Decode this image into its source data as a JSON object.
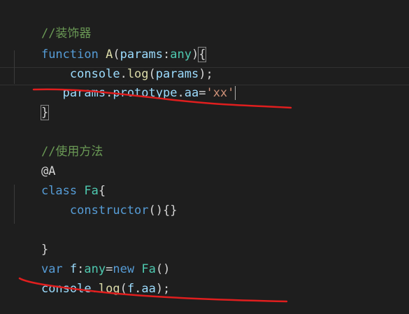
{
  "theme": {
    "background": "#1e1e1e",
    "comment": "#6a9955",
    "keyword": "#569cd6",
    "function": "#dcdcaa",
    "variable": "#9cdcfe",
    "type": "#4ec9b0",
    "string": "#ce9178",
    "text": "#d4d4d4",
    "annotation": "#e01e1e"
  },
  "code": {
    "l1": {
      "comment": "//装饰器"
    },
    "l2": {
      "kw": "function",
      "sp1": " ",
      "fn": "A",
      "p1": "(",
      "param": "params",
      "colon": ":",
      "type": "any",
      "p2": ")",
      "brace": "{"
    },
    "l3": {
      "indent": "    ",
      "obj": "console",
      "dot": ".",
      "method": "log",
      "p1": "(",
      "arg": "params",
      "p2": ");"
    },
    "l4": {
      "indent": "   ",
      "obj": "params",
      "d1": ".",
      "prop1": "prototype",
      "d2": ".",
      "prop2": "aa",
      "eq": "=",
      "str": "'xx'"
    },
    "l5": {
      "brace": "}"
    },
    "l7": {
      "comment": "//使用方法"
    },
    "l8": {
      "decorator": "@A"
    },
    "l9": {
      "kw": "class",
      "sp1": " ",
      "cls": "Fa",
      "brace": "{"
    },
    "l10": {
      "indent": "    ",
      "ctor": "constructor",
      "rest": "(){}"
    },
    "l12": {
      "brace": "}"
    },
    "l13": {
      "kw": "var",
      "sp1": " ",
      "name": "f",
      "colon": ":",
      "type": "any",
      "eq": "=",
      "newkw": "new",
      "sp2": " ",
      "cls": "Fa",
      "call": "()"
    },
    "l14": {
      "obj": "console",
      "dot": ".",
      "method": "log",
      "p1": "(",
      "arg1": "f",
      "d2": ".",
      "arg2": "aa",
      "p2": ");"
    }
  }
}
